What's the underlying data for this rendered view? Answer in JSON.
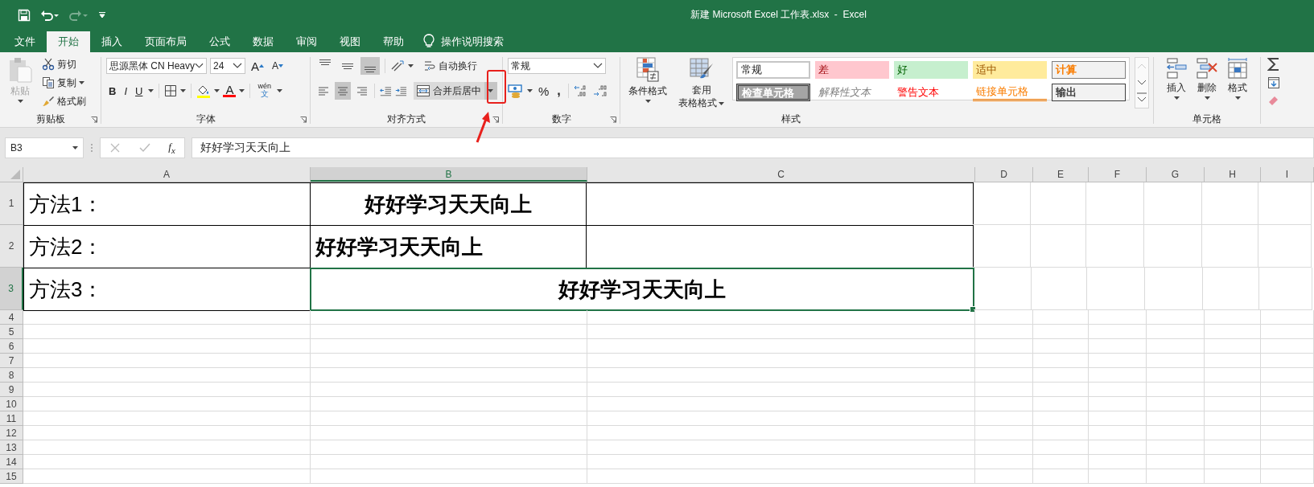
{
  "title_bar": {
    "title": "新建 Microsoft Excel 工作表.xlsx  -  Excel",
    "redo": {
      "disabled": true
    }
  },
  "tabs": [
    {
      "label": "文件",
      "selected": false
    },
    {
      "label": "开始",
      "selected": true
    },
    {
      "label": "插入",
      "selected": false
    },
    {
      "label": "页面布局",
      "selected": false
    },
    {
      "label": "公式",
      "selected": false
    },
    {
      "label": "数据",
      "selected": false
    },
    {
      "label": "审阅",
      "selected": false
    },
    {
      "label": "视图",
      "selected": false
    },
    {
      "label": "帮助",
      "selected": false
    }
  ],
  "tell_me": {
    "label": "操作说明搜索"
  },
  "ribbon": {
    "clipboard": {
      "label": "剪贴板",
      "paste": {
        "label": "粘贴",
        "disabled": true
      },
      "cut": "剪切",
      "copy": "复制",
      "format_painter": "格式刷"
    },
    "font": {
      "label": "字体",
      "font_name": "思源黑体 CN Heavy",
      "font_size": "24",
      "grow_font": "A",
      "shrink_font": "A",
      "bold": "B",
      "italic": "I",
      "underline": "U",
      "font_color": "A",
      "phonetic": {
        "top": "wén",
        "bottom": "文"
      }
    },
    "alignment": {
      "label": "对齐方式",
      "vertical": [
        {
          "kind": "top",
          "selected": false
        },
        {
          "kind": "middle",
          "selected": false
        },
        {
          "kind": "bottom",
          "selected": true
        }
      ],
      "horizontal": [
        {
          "kind": "left",
          "selected": false
        },
        {
          "kind": "center",
          "selected": true
        },
        {
          "kind": "right",
          "selected": false
        }
      ],
      "wrap_text": "自动换行",
      "merge": {
        "label": "合并后居中",
        "selected": true
      }
    },
    "number": {
      "label": "数字",
      "format": "常规",
      "percent": "%",
      "comma": ","
    },
    "styles": {
      "label": "样式",
      "conditional_formatting": "条件格式",
      "format_as_table": [
        "套用",
        "表格格式"
      ],
      "cell_styles": [
        {
          "label": "常规",
          "kind": "normal"
        },
        {
          "label": "差",
          "kind": "bad"
        },
        {
          "label": "好",
          "kind": "good"
        },
        {
          "label": "适中",
          "kind": "neutral"
        },
        {
          "label": "计算",
          "kind": "calculation"
        },
        {
          "label": "检查单元格",
          "kind": "check"
        },
        {
          "label": "解释性文本",
          "kind": "explanatory"
        },
        {
          "label": "警告文本",
          "kind": "warning"
        },
        {
          "label": "链接单元格",
          "kind": "linked"
        },
        {
          "label": "输出",
          "kind": "output"
        }
      ]
    },
    "cells": {
      "label": "单元格",
      "buttons": [
        {
          "label": "插入",
          "kind": "insert"
        },
        {
          "label": "删除",
          "kind": "delete"
        },
        {
          "label": "格式",
          "kind": "format"
        }
      ]
    }
  },
  "formula_bar": {
    "name_box": "B3",
    "fx": "f$_{x}$",
    "formula": "好好学习天天向上"
  },
  "columns": [
    {
      "label": "A",
      "selected": false
    },
    {
      "label": "B",
      "selected": true
    },
    {
      "label": "C",
      "selected": false
    },
    {
      "label": "D",
      "selected": false
    },
    {
      "label": "E",
      "selected": false
    },
    {
      "label": "F",
      "selected": false
    },
    {
      "label": "G",
      "selected": false
    },
    {
      "label": "H",
      "selected": false
    },
    {
      "label": "I",
      "selected": false
    }
  ],
  "rows": [
    {
      "label": "1",
      "selected": false,
      "cells": [
        {
          "text": "方法1：",
          "kind": "label",
          "active": false
        },
        {
          "text": "好好学习天天向上",
          "kind": "value",
          "centered": true,
          "active": false
        },
        {
          "kind": "blank",
          "active": false
        }
      ]
    },
    {
      "label": "2",
      "selected": false,
      "cells": [
        {
          "text": "方法2：",
          "kind": "label",
          "active": false
        },
        {
          "text": "好好学习天天向上",
          "kind": "value",
          "centered": false,
          "active": false
        },
        {
          "kind": "blank",
          "active": false
        }
      ]
    },
    {
      "label": "3",
      "selected": true,
      "cells": [
        {
          "text": "方法3：",
          "kind": "label",
          "active": false
        },
        {
          "text": "好好学习天天向上",
          "kind": "value",
          "centered": true,
          "merged": true,
          "active": true
        }
      ]
    },
    {
      "label": "4",
      "selected": false
    },
    {
      "label": "5",
      "selected": false
    },
    {
      "label": "6",
      "selected": false
    },
    {
      "label": "7",
      "selected": false
    },
    {
      "label": "8",
      "selected": false
    },
    {
      "label": "9",
      "selected": false
    },
    {
      "label": "10",
      "selected": false
    },
    {
      "label": "11",
      "selected": false
    },
    {
      "label": "12",
      "selected": false
    },
    {
      "label": "13",
      "selected": false
    },
    {
      "label": "14",
      "selected": false
    },
    {
      "label": "15",
      "selected": false
    }
  ]
}
